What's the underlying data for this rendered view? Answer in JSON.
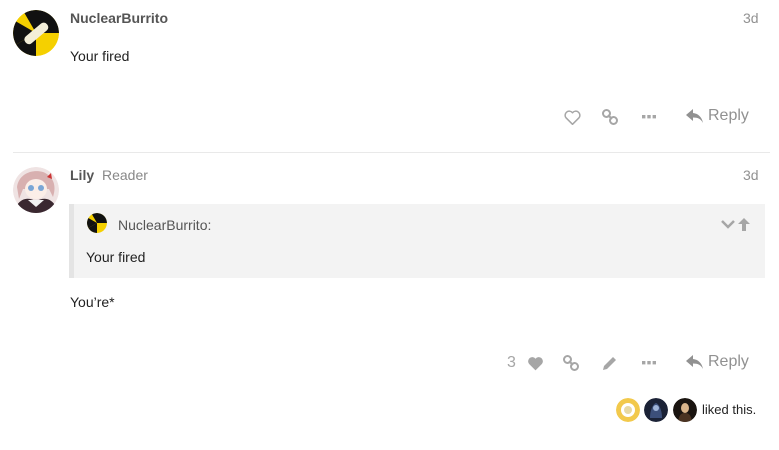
{
  "posts": [
    {
      "username": "NuclearBurrito",
      "date": "3d",
      "body": "Your fired",
      "reply_label": "Reply"
    },
    {
      "username": "Lily",
      "user_title": "Reader",
      "date": "3d",
      "quote": {
        "author": "NuclearBurrito:",
        "text": "Your fired"
      },
      "body": "You’re*",
      "like_count": "3",
      "reply_label": "Reply",
      "liked_by_text": "liked this."
    }
  ],
  "icons": [
    "heart-icon",
    "link-icon",
    "more-icon",
    "reply-icon",
    "pencil-icon",
    "chevron-down-icon",
    "arrow-up-icon"
  ],
  "colors": {
    "accent_yellow": "#f5d000",
    "text_muted": "#919191",
    "quote_bg": "#f3f3f3"
  }
}
